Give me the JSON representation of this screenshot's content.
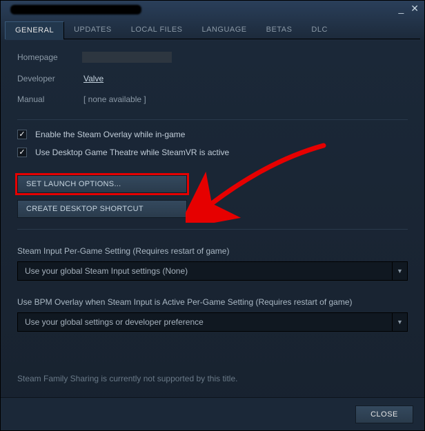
{
  "tabs": {
    "general": "GENERAL",
    "updates": "UPDATES",
    "local_files": "LOCAL FILES",
    "language": "LANGUAGE",
    "betas": "BETAS",
    "dlc": "DLC"
  },
  "info": {
    "homepage_label": "Homepage",
    "developer_label": "Developer",
    "developer_value": "Valve",
    "manual_label": "Manual",
    "manual_value": "[ none available ]"
  },
  "checkboxes": {
    "overlay": "Enable the Steam Overlay while in-game",
    "theatre": "Use Desktop Game Theatre while SteamVR is active"
  },
  "buttons": {
    "launch_options": "SET LAUNCH OPTIONS...",
    "desktop_shortcut": "CREATE DESKTOP SHORTCUT",
    "close": "CLOSE"
  },
  "steam_input": {
    "label": "Steam Input Per-Game Setting (Requires restart of game)",
    "value": "Use your global Steam Input settings (None)"
  },
  "bpm_overlay": {
    "label": "Use BPM Overlay when Steam Input is Active Per-Game Setting (Requires restart of game)",
    "value": "Use your global settings or developer preference"
  },
  "footer": {
    "family_sharing": "Steam Family Sharing is currently not supported by this title."
  }
}
